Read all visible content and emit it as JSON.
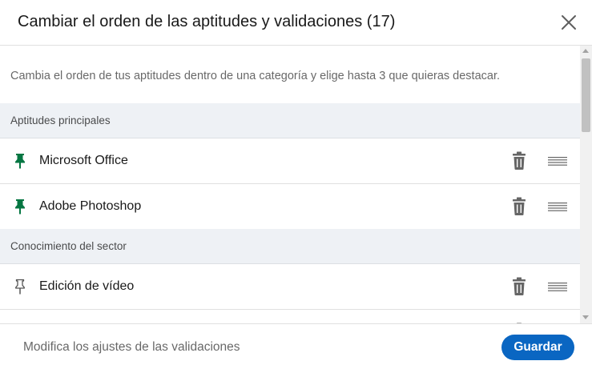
{
  "dialog": {
    "title": "Cambiar el orden de las aptitudes y validaciones (17)",
    "close_icon": "close-icon",
    "intro": "Cambia el orden de tus aptitudes dentro de una categoría y elige hasta 3 que quieras destacar."
  },
  "sections": [
    {
      "title": "Aptitudes principales",
      "items": [
        {
          "label": "Microsoft Office",
          "pinned": true,
          "pin_icon": "pin-filled-icon"
        },
        {
          "label": "Adobe Photoshop",
          "pinned": true,
          "pin_icon": "pin-filled-icon"
        }
      ]
    },
    {
      "title": "Conocimiento del sector",
      "items": [
        {
          "label": "Edición de vídeo",
          "pinned": false,
          "pin_icon": "pin-outline-icon"
        }
      ]
    }
  ],
  "footer": {
    "settings_link": "Modifica los ajustes de las validaciones",
    "save_label": "Guardar"
  },
  "colors": {
    "primary": "#0a66c2",
    "pinned": "#057642",
    "section_bg": "#eef1f5",
    "muted_icon": "#666666"
  }
}
